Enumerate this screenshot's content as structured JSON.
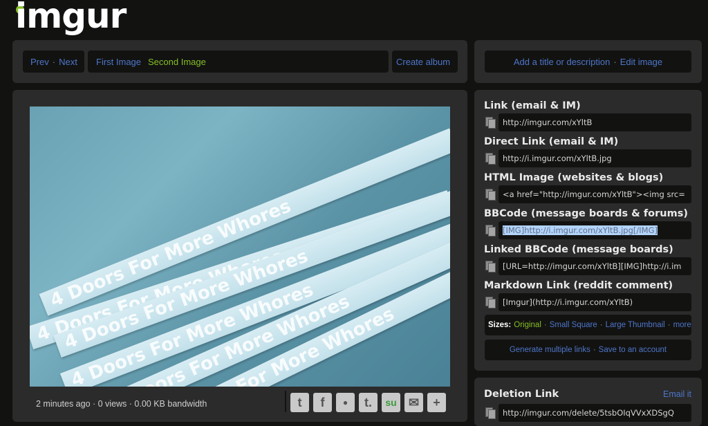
{
  "logo": {
    "text": "imgur"
  },
  "nav": {
    "prev": "Prev",
    "sep": "·",
    "next": "Next",
    "first_image": "First Image",
    "second_image": "Second Image",
    "create_album": "Create album"
  },
  "meta_bar": {
    "add_title": "Add a title or description",
    "sep": "·",
    "edit_image": "Edit image"
  },
  "image": {
    "stats": "2 minutes ago · 0 views · 0.00 KB bandwidth",
    "strip_text": "4 Doors For More Whores"
  },
  "share_icons": [
    "twitter-icon",
    "facebook-icon",
    "reddit-icon",
    "tumblr-icon",
    "stumbleupon-icon",
    "email-icon",
    "more-icon"
  ],
  "share_glyphs": [
    "t",
    "f",
    "●",
    "t.",
    "su",
    "✉",
    "+"
  ],
  "links": [
    {
      "label": "Link (email & IM)",
      "value": "http://imgur.com/xYltB"
    },
    {
      "label": "Direct Link (email & IM)",
      "value": "http://i.imgur.com/xYltB.jpg"
    },
    {
      "label": "HTML Image (websites & blogs)",
      "value": "<a href=\"http://imgur.com/xYltB\"><img src="
    },
    {
      "label": "BBCode (message boards & forums)",
      "value": "[IMG]http://i.imgur.com/xYltB.jpg[/IMG]"
    },
    {
      "label": "Linked BBCode (message boards)",
      "value": "[URL=http://imgur.com/xYltB][IMG]http://i.im"
    },
    {
      "label": "Markdown Link (reddit comment)",
      "value": "[Imgur](http://i.imgur.com/xYltB)"
    }
  ],
  "sizes": {
    "label": "Sizes:",
    "original": "Original",
    "small_square": "Small Square",
    "large_thumbnail": "Large Thumbnail",
    "more": "more",
    "sep": "·"
  },
  "actions": {
    "generate": "Generate multiple links",
    "sep": "·",
    "save": "Save to an account"
  },
  "deletion": {
    "label": "Deletion Link",
    "email_it": "Email it",
    "value": "http://imgur.com/delete/5tsbOIqVVxXDSgQ"
  },
  "colors": {
    "accent_green": "#85bf25",
    "link_blue": "#4e76c9",
    "panel": "#2b2b2b",
    "field": "#121211"
  }
}
